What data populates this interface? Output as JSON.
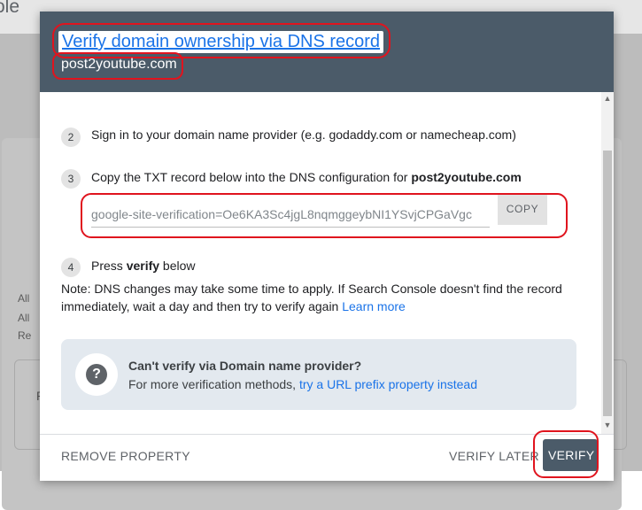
{
  "background": {
    "title_fragment": "ole",
    "bullets": [
      "All",
      "All",
      "Re"
    ],
    "box_fragment": "P"
  },
  "modal": {
    "title": "Verify domain ownership via DNS record",
    "domain": "post2youtube.com",
    "steps": [
      {
        "number": "2",
        "text": "Sign in to your domain name provider (e.g. godaddy.com or namecheap.com)"
      },
      {
        "number": "3",
        "text_prefix": "Copy the TXT record below into the DNS configuration for ",
        "text_bold": "post2youtube.com"
      },
      {
        "number": "4",
        "text_prefix": "Press ",
        "text_bold": "verify",
        "text_suffix": " below"
      }
    ],
    "txt_record": "google-site-verification=Oe6KA3Sc4jgL8nqmggeybNI1YSvjCPGaVgc",
    "copy_label": "COPY",
    "note_text": "Note: DNS changes may take some time to apply. If Search Console doesn't find the record immediately, wait a day and then try to verify again",
    "note_link": "Learn more",
    "help": {
      "title": "Can't verify via Domain name provider?",
      "body_prefix": "For more verification methods,",
      "body_link": "try a URL prefix property instead"
    },
    "footer": {
      "remove_label": "REMOVE PROPERTY",
      "later_label": "VERIFY LATER",
      "verify_label": "VERIFY"
    }
  },
  "colors": {
    "header_bg": "#4b5b69",
    "link": "#1a73e8",
    "annotation_ring": "#e0141e",
    "help_bg": "#e3e9ef"
  },
  "icons": {
    "help": "help-circle-icon",
    "scroll_up": "chevron-up-icon",
    "scroll_down": "chevron-down-icon"
  }
}
